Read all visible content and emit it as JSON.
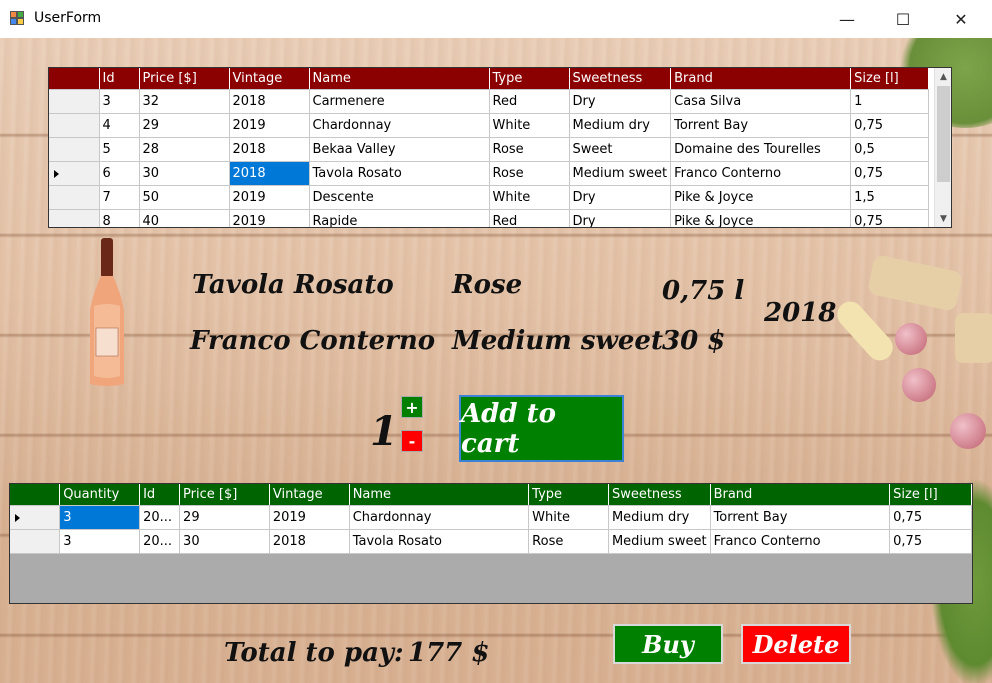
{
  "window": {
    "title": "UserForm",
    "minimize": "—",
    "maximize": "☐",
    "close": "✕"
  },
  "wines": {
    "columns": [
      "Id",
      "Price [$]",
      "Vintage",
      "Name",
      "Type",
      "Sweetness",
      "Brand",
      "Size [l]"
    ],
    "rows": [
      [
        "3",
        "32",
        "2018",
        "Carmenere",
        "Red",
        "Dry",
        "Casa Silva",
        "1"
      ],
      [
        "4",
        "29",
        "2019",
        "Chardonnay",
        "White",
        "Medium dry",
        "Torrent Bay",
        "0,75"
      ],
      [
        "5",
        "28",
        "2018",
        "Bekaa Valley",
        "Rose",
        "Sweet",
        "Domaine des Tourelles",
        "0,5"
      ],
      [
        "6",
        "30",
        "2018",
        "Tavola Rosato",
        "Rose",
        "Medium sweet",
        "Franco Conterno",
        "0,75"
      ],
      [
        "7",
        "50",
        "2019",
        "Descente",
        "White",
        "Dry",
        "Pike & Joyce",
        "1,5"
      ],
      [
        "8",
        "40",
        "2019",
        "Rapide",
        "Red",
        "Dry",
        "Pike & Joyce",
        "0,75"
      ]
    ],
    "current_row": 3,
    "selected_cell": {
      "row": 3,
      "col": 2
    },
    "header_color": "#8b0000"
  },
  "details": {
    "name": "Tavola Rosato",
    "type": "Rose",
    "size": "0,75 l",
    "vintage": "2018",
    "brand": "Franco Conterno",
    "sweetness": "Medium sweet",
    "price": "30 $"
  },
  "quantity": {
    "value": "1",
    "plus": "+",
    "minus": "-"
  },
  "add_to_cart_label": "Add to cart",
  "cart": {
    "columns": [
      "Quantity",
      "Id",
      "Price [$]",
      "Vintage",
      "Name",
      "Type",
      "Sweetness",
      "Brand",
      "Size [l]"
    ],
    "rows": [
      [
        "3",
        "20...",
        "29",
        "2019",
        "Chardonnay",
        "White",
        "Medium dry",
        "Torrent Bay",
        "0,75"
      ],
      [
        "3",
        "20...",
        "30",
        "2018",
        "Tavola Rosato",
        "Rose",
        "Medium sweet",
        "Franco Conterno",
        "0,75"
      ]
    ],
    "current_row": 0,
    "selected_cell": {
      "row": 0,
      "col": 0
    },
    "header_color": "#006400"
  },
  "total": {
    "label": "Total to pay:",
    "value": "177 $"
  },
  "buy_label": "Buy",
  "delete_label": "Delete",
  "colors": {
    "green": "#008000",
    "red": "#ff0000",
    "selection": "#0078d7"
  }
}
